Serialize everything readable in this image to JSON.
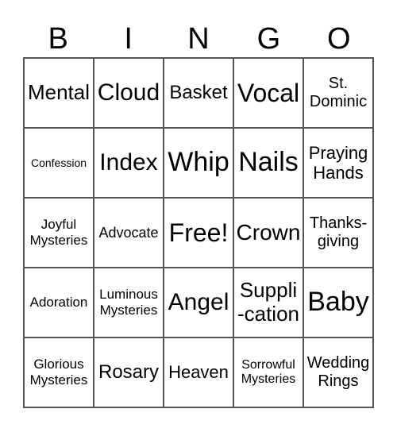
{
  "title_letters": [
    "B",
    "I",
    "N",
    "G",
    "O"
  ],
  "cells": [
    [
      "Mental",
      "Cloud",
      "Basket",
      "Vocal",
      "St.\nDominic"
    ],
    [
      "Confession",
      "Index",
      "Whip",
      "Nails",
      "Praying\nHands"
    ],
    [
      "Joyful\nMysteries",
      "Advocate",
      "Free!",
      "Crown",
      "Thanks-\ngiving"
    ],
    [
      "Adoration",
      "Luminous\nMysteries",
      "Angel",
      "Suppli\n-cation",
      "Baby"
    ],
    [
      "Glorious\nMysteries",
      "Rosary",
      "Heaven",
      "Sorrowful\nMysteries",
      "Wedding\nRings"
    ]
  ]
}
